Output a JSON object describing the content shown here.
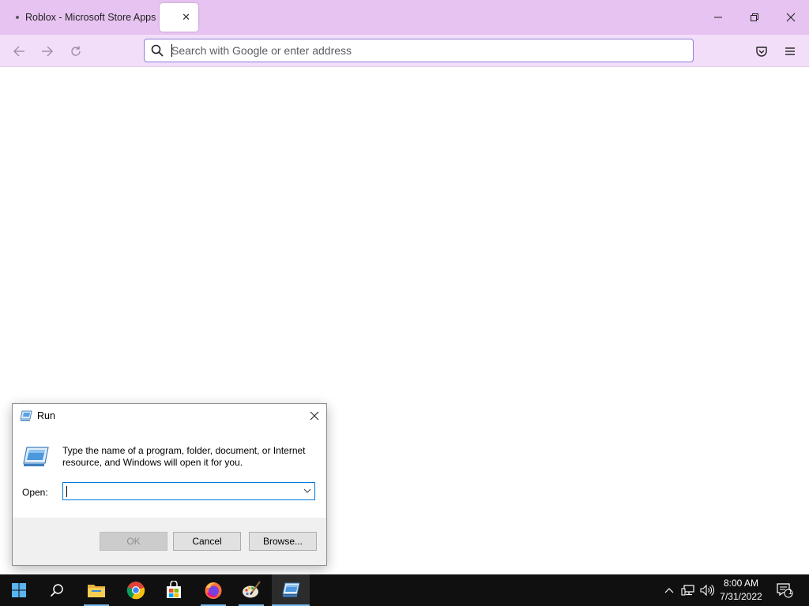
{
  "browser": {
    "tabs": [
      {
        "title": "Roblox - Microsoft Store Apps",
        "active": false
      },
      {
        "title": "",
        "active": true
      }
    ],
    "url_placeholder": "Search with Google or enter address",
    "url_value": "",
    "theme": {
      "titlebar": "#e6c3f0",
      "navbar": "#f3defa",
      "focus_ring": "#8a7fd6"
    }
  },
  "run_dialog": {
    "title": "Run",
    "description": "Type the name of a program, folder, document, or Internet resource, and Windows will open it for you.",
    "open_label": "Open:",
    "open_value": "",
    "buttons": {
      "ok": "OK",
      "cancel": "Cancel",
      "browse": "Browse..."
    }
  },
  "taskbar": {
    "pinned": [
      "windows-start-icon",
      "search-icon",
      "file-explorer-icon",
      "chrome-icon",
      "microsoft-store-icon",
      "firefox-icon",
      "paint-icon",
      "run-icon"
    ],
    "clock_time": "8:00 AM",
    "clock_date": "7/31/2022",
    "notification_count": "1",
    "accent": "#76b9ed"
  }
}
